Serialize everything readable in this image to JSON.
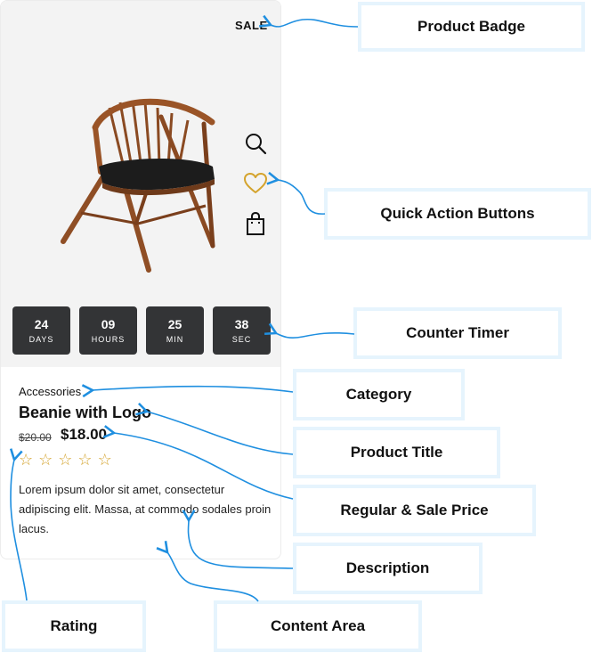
{
  "product": {
    "badge": "SALE",
    "image_alt": "wooden chair with black seat",
    "category": "Accessories",
    "title": "Beanie with Logo",
    "regular_price": "$20.00",
    "sale_price": "$18.00",
    "rating": {
      "value": 0,
      "max": 5
    },
    "description": "Lorem ipsum dolor sit amet, consectetur adipiscing elit. Massa, at commodo sodales proin lacus."
  },
  "quick_actions": [
    {
      "name": "search-icon",
      "color": "#111111"
    },
    {
      "name": "heart-icon",
      "color": "#d4a32c"
    },
    {
      "name": "bag-icon",
      "color": "#111111"
    }
  ],
  "timer": [
    {
      "value": "24",
      "label": "DAYS"
    },
    {
      "value": "09",
      "label": "HOURS"
    },
    {
      "value": "25",
      "label": "MIN"
    },
    {
      "value": "38",
      "label": "SEC"
    }
  ],
  "callouts": {
    "product_badge": "Product Badge",
    "quick_action_buttons": "Quick Action Buttons",
    "counter_timer": "Counter Timer",
    "category": "Category",
    "product_title": "Product Title",
    "regular_sale_price": "Regular & Sale Price",
    "description": "Description",
    "rating": "Rating",
    "content_area": "Content Area"
  },
  "colors": {
    "media_background": "#f3f3f3",
    "timer_background": "#333436",
    "star": "#d4a32c",
    "arrow": "#1f8fe0",
    "callout_border": "#e6f4fd"
  }
}
